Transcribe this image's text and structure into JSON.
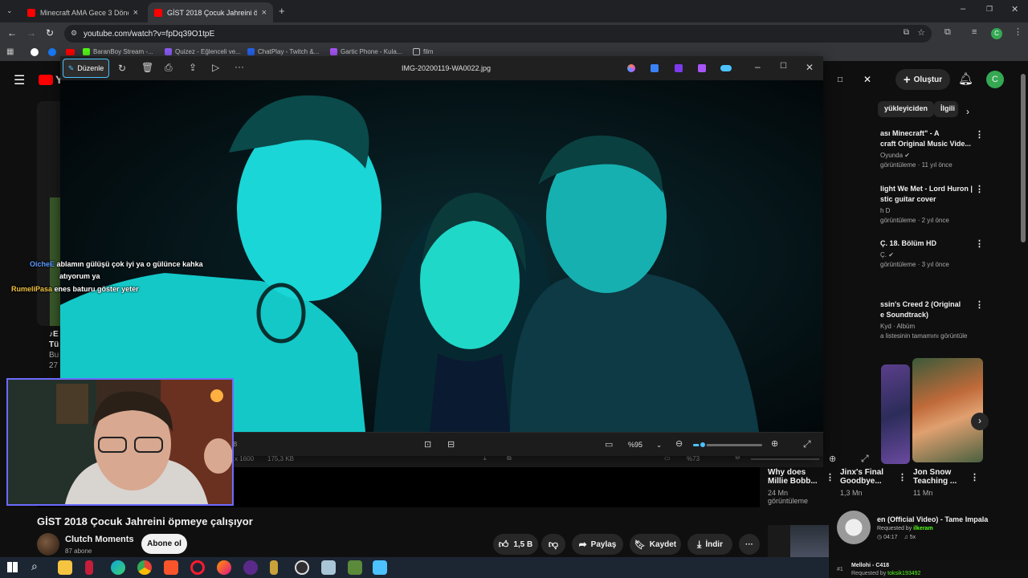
{
  "browser": {
    "tabs": [
      {
        "title": "Minecraft AMA Gece 3 Dönercil"
      },
      {
        "title": "GİST 2018 Çocuk Jahreini öpme"
      }
    ],
    "url": "youtube.com/watch?v=fpDq39O1tpE",
    "bookmarks": [
      "BaranBoy Stream -...",
      "Quizez - Eğlenceli ve...",
      "ChatPlay - Twitch &...",
      "Gartic Phone - Kula...",
      "film"
    ],
    "profile_initial": "C"
  },
  "youtube": {
    "logo": "Y",
    "create_label": "Oluştur",
    "avatar_initial": "C",
    "chips": [
      "yükleyiciden",
      "İlgili"
    ],
    "recommendations": [
      {
        "title1": "ası Minecraft\" - A",
        "title2": "craft Original Music Vide...",
        "channel": "Oyunda",
        "meta": "görüntüleme · 11 yıl önce"
      },
      {
        "title1": "light We Met - Lord Huron |",
        "title2": "stic guitar cover",
        "channel": "h D",
        "meta": "görüntüleme · 2 yıl önce"
      },
      {
        "title1": "Ç. 18. Bölüm HD",
        "title2": "",
        "channel": "Ç.",
        "meta": "görüntüleme · 3 yıl önce"
      },
      {
        "title1": "ssin's Creed 2 (Original",
        "title2": "e Soundtrack)",
        "channel": "Kyd · Albüm",
        "meta": "a listesinin tamamını görüntüle"
      }
    ],
    "shorts": [
      {
        "title1": "Why does",
        "title2": "Millie Bobb...",
        "views": "24 Mn",
        "views2": "görüntüleme"
      },
      {
        "title1": "Jinx's Final",
        "title2": "Goodbye... ",
        "views": "1,3 Mn",
        "views2": ""
      },
      {
        "title1": "Jon Snow",
        "title2": "Teaching ...",
        "views": "11 Mn",
        "views2": ""
      }
    ],
    "left_fragment": {
      "line1": "♪E",
      "line2": "Tü",
      "line3": "Bu",
      "line4": "27"
    },
    "video_title": "GİST 2018 Çocuk Jahreini öpmeye çalışıyor",
    "channel_name": "Clutch Moments",
    "subscribers": "87 abone",
    "subscribe_label": "Abone ol",
    "likes": "1,5 B",
    "share_label": "Paylaş",
    "save_label": "Kaydet",
    "download_label": "İndir"
  },
  "photos_viewer": {
    "edit_label": "Düzenle",
    "filename": "IMG-20200119-WA0022.jpg",
    "zoom": "%95",
    "zoom_fraction": 0.14,
    "behind_zoom": "%73",
    "behind_info_res": "x 1600",
    "behind_info_size": "175,3 KB",
    "behind_info_b": "B"
  },
  "chat": [
    {
      "user": "OicheE",
      "user_color": "#5b9bff",
      "text": "ablamın gülüşü çok iyi ya o gülünce kahka"
    },
    {
      "user": "",
      "user_color": "#ffffff",
      "text": "atıyorum ya"
    },
    {
      "user": "RumeliPasa",
      "user_color": "#f0c040",
      "text": "enes baturu göster yeter"
    }
  ],
  "now_playing": {
    "title": "en (Official Video) - Tame Impala",
    "requested_by_label": "Requested by",
    "requested_by": "ilkeram",
    "duration": "04:17",
    "count": "5x",
    "queue_index": "#1",
    "next_title": "Mellohi - C418",
    "next_requested_label": "Requested by",
    "next_requested_by": "toksik193492"
  },
  "colors": {
    "accent_viewer": "#4cc2ff",
    "youtube_red": "#ff0000",
    "avatar_green": "#34a853"
  }
}
